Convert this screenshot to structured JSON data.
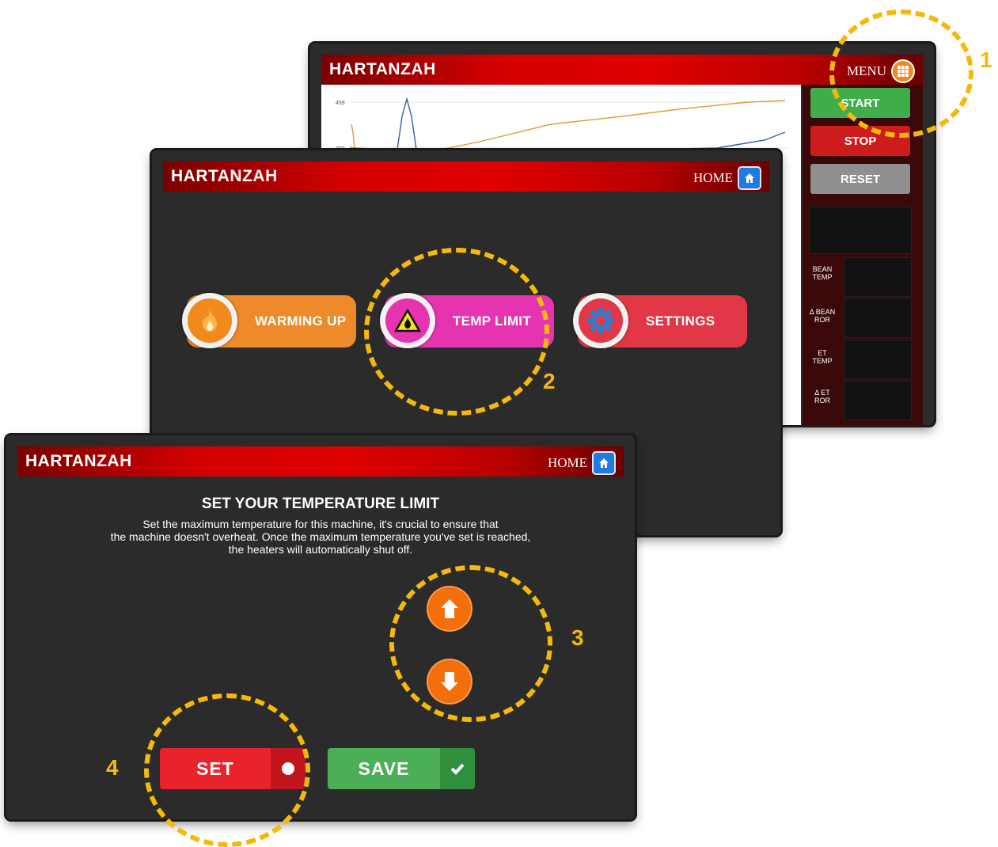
{
  "brand": "HARTANZAH",
  "screen1": {
    "menu_label": "MENU",
    "buttons": {
      "start": "START",
      "stop": "STOP",
      "reset": "RESET"
    },
    "chart_label": "459",
    "chart_label2": "290",
    "panels": [
      {
        "top": "BEAN",
        "bottom": "TEMP"
      },
      {
        "top": "Δ BEAN",
        "bottom": "ROR"
      },
      {
        "top": "ET",
        "bottom": "TEMP"
      },
      {
        "top": "Δ ET",
        "bottom": "ROR"
      }
    ]
  },
  "screen2": {
    "home_label": "HOME",
    "options": {
      "warming": "WARMING UP",
      "temp_limit": "TEMP LIMIT",
      "settings": "SETTINGS"
    }
  },
  "screen3": {
    "home_label": "HOME",
    "title": "SET YOUR TEMPERATURE LIMIT",
    "description": [
      "Set the maximum temperature for this machine, it's crucial to ensure that",
      "the machine doesn't overheat.  Once the maximum temperature you've set is reached,",
      "the heaters will automatically shut off."
    ],
    "set_label": "SET",
    "save_label": "SAVE"
  },
  "annotations": {
    "one": "1",
    "two": "2",
    "three": "3",
    "four": "4"
  },
  "colors": {
    "accent_annotation": "#f5b90a",
    "start": "#3fae4a",
    "stop": "#cc1c1c",
    "reset": "#8f8f8f",
    "temp_limit": "#e633b0",
    "warming": "#ee8a2a",
    "settings": "#e23747"
  }
}
